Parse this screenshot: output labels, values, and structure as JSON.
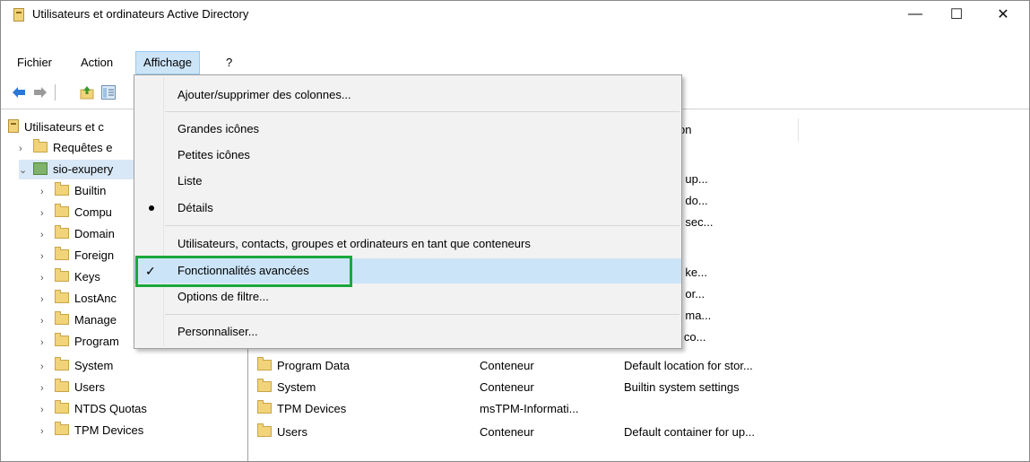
{
  "window": {
    "title": "Utilisateurs et ordinateurs Active Directory",
    "controls": {
      "minimize": "—",
      "maximize": "☐",
      "close": "✕"
    }
  },
  "menubar": {
    "items": [
      "Fichier",
      "Action",
      "Affichage",
      "?"
    ],
    "open_item": "Affichage"
  },
  "tree": {
    "root": "Utilisateurs et c",
    "saved_queries": "Requêtes e",
    "domain": "sio-exupery",
    "children": [
      "Builtin",
      "Compu",
      "Domain",
      "Foreign",
      "Keys",
      "LostAnc",
      "Manage",
      "Program",
      "System",
      "Users",
      "NTDS Quotas",
      "TPM Devices"
    ]
  },
  "list": {
    "header_partial": "on",
    "partial_descriptions": [
      "ontainer for up...",
      "ontainer for do...",
      "ontainer for sec...",
      "ontainer for ke...",
      "ontainer for or...",
      "ontainer for ma...",
      "ecifications co..."
    ],
    "rows": [
      {
        "name": "Program Data",
        "type": "Conteneur",
        "description": "Default location for stor..."
      },
      {
        "name": "System",
        "type": "Conteneur",
        "description": "Builtin system settings"
      },
      {
        "name": "TPM Devices",
        "type": "msTPM-Informati...",
        "description": ""
      },
      {
        "name": "Users",
        "type": "Conteneur",
        "description": "Default container for up..."
      }
    ]
  },
  "view_menu": {
    "items": {
      "add_remove_columns": "Ajouter/supprimer des colonnes...",
      "large_icons": "Grandes icônes",
      "small_icons": "Petites icônes",
      "list": "Liste",
      "details": "Détails",
      "users_as_containers": "Utilisateurs, contacts, groupes et ordinateurs en tant que conteneurs",
      "advanced_features": "Fonctionnalités avancées",
      "filter_options": "Options de filtre...",
      "customize": "Personnaliser..."
    },
    "details_selected": true,
    "advanced_features_checked": true
  },
  "colors": {
    "highlight_box": "#1aa83c",
    "menu_hover": "#cce4f7",
    "tree_selection": "#d9e8f7"
  }
}
